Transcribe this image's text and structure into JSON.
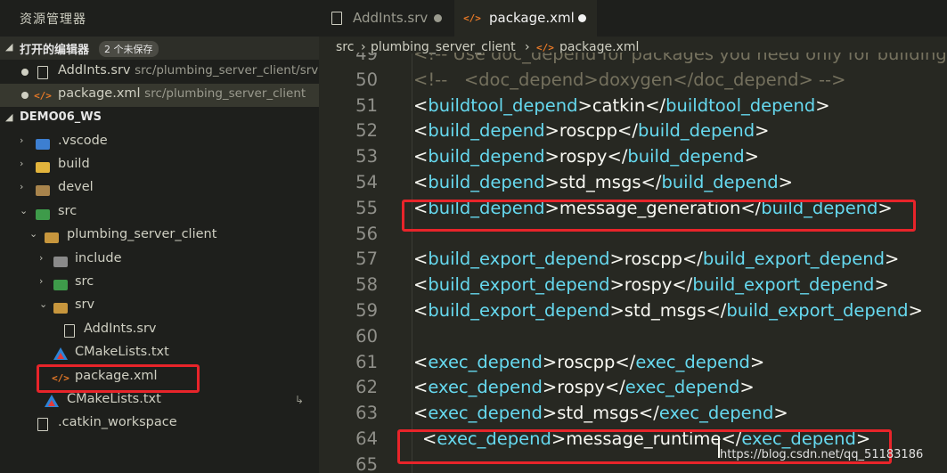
{
  "sidebar": {
    "title": "资源管理器",
    "open_editors": {
      "label": "打开的编辑器",
      "badge": "2 个未保存",
      "items": [
        {
          "name": "AddInts.srv",
          "path": "src/plumbing_server_client/srv"
        },
        {
          "name": "package.xml",
          "path": "src/plumbing_server_client"
        }
      ]
    },
    "workspace": {
      "label": "DEMO06_WS",
      "items": [
        {
          "label": ".vscode"
        },
        {
          "label": "build"
        },
        {
          "label": "devel"
        },
        {
          "label": "src"
        },
        {
          "label": "plumbing_server_client"
        },
        {
          "label": "include"
        },
        {
          "label": "src"
        },
        {
          "label": "srv"
        },
        {
          "label": "AddInts.srv"
        },
        {
          "label": "CMakeLists.txt"
        },
        {
          "label": "package.xml"
        },
        {
          "label": "CMakeLists.txt"
        },
        {
          "label": ".catkin_workspace"
        }
      ]
    },
    "xml_icon": "</>"
  },
  "tabs": [
    {
      "label": "AddInts.srv",
      "dirty": true
    },
    {
      "label": "package.xml",
      "dirty": true,
      "active": true
    }
  ],
  "breadcrumb": {
    "part1": "src",
    "sep": "›",
    "part2": "plumbing_server_client",
    "part3": "package.xml"
  },
  "editor": {
    "lines": [
      {
        "num": "49",
        "text": "<!-- Use doc_depend for packages you need only for building documentation: -->"
      },
      {
        "num": "50",
        "text": "<!--   <doc_depend>doxygen</doc_depend> -->"
      },
      {
        "num": "51",
        "tag": "buildtool_depend",
        "value": "catkin"
      },
      {
        "num": "52",
        "tag": "build_depend",
        "value": "roscpp"
      },
      {
        "num": "53",
        "tag": "build_depend",
        "value": "rospy"
      },
      {
        "num": "54",
        "tag": "build_depend",
        "value": "std_msgs"
      },
      {
        "num": "55",
        "tag": "build_depend",
        "value": "message_generation"
      },
      {
        "num": "56"
      },
      {
        "num": "57",
        "tag": "build_export_depend",
        "value": "roscpp"
      },
      {
        "num": "58",
        "tag": "build_export_depend",
        "value": "rospy"
      },
      {
        "num": "59",
        "tag": "build_export_depend",
        "value": "std_msgs"
      },
      {
        "num": "60"
      },
      {
        "num": "61",
        "tag": "exec_depend",
        "value": "roscpp"
      },
      {
        "num": "62",
        "tag": "exec_depend",
        "value": "rospy"
      },
      {
        "num": "63",
        "tag": "exec_depend",
        "value": "std_msgs"
      },
      {
        "num": "64",
        "tag": "exec_depend",
        "value": "message_runtime"
      },
      {
        "num": "65"
      }
    ]
  },
  "watermark": "https://blog.csdn.net/qq_51183186",
  "colors": {
    "tag": "#66d9ef",
    "comment": "#75715e",
    "highlight_box": "#e8242a"
  }
}
